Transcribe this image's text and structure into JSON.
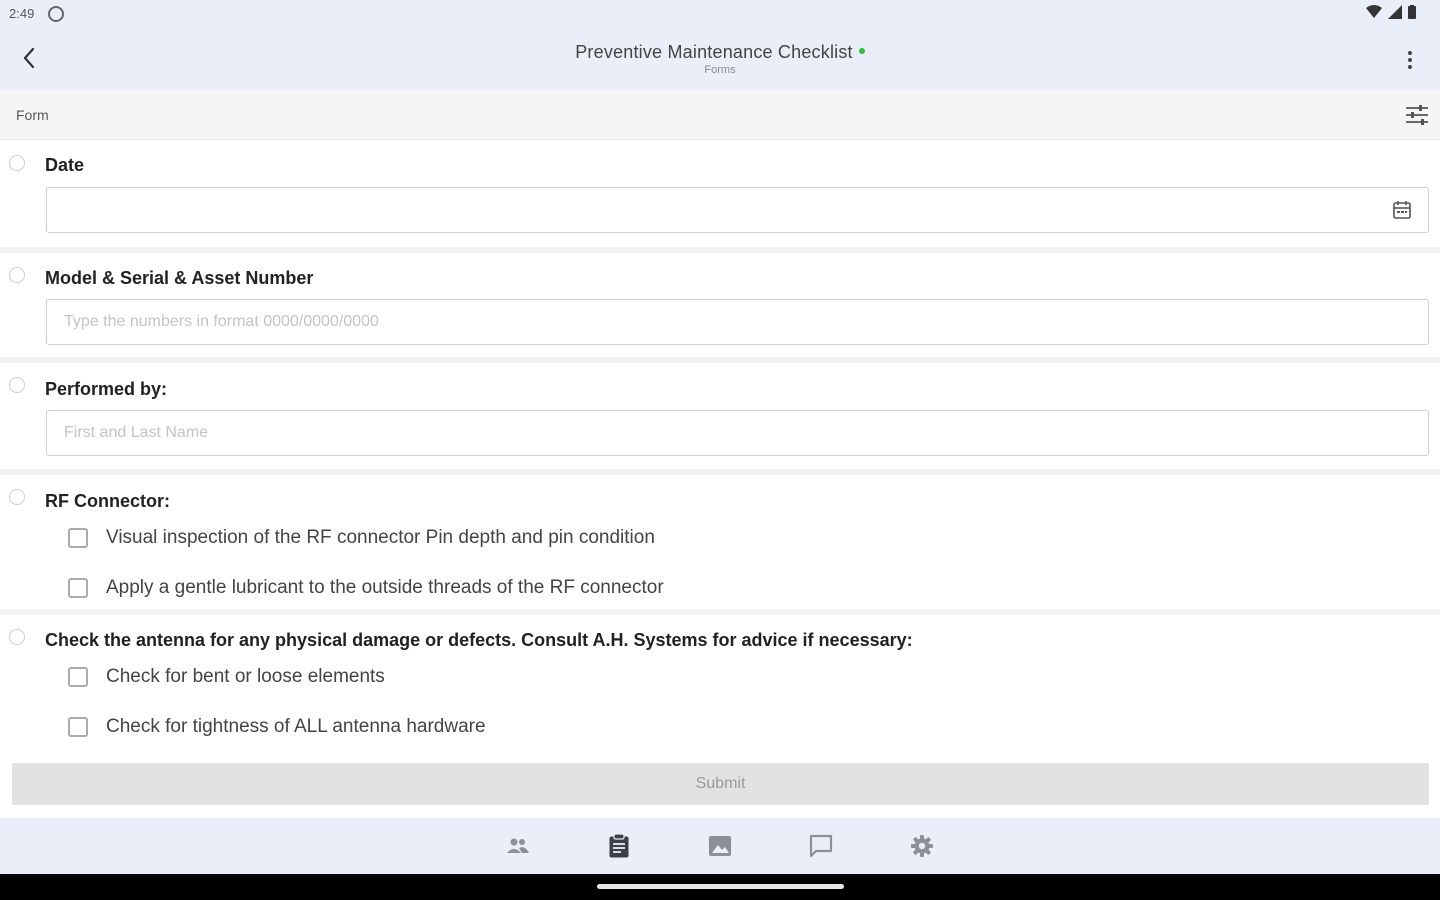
{
  "status": {
    "time": "2:49"
  },
  "header": {
    "title": "Preventive Maintenance Checklist",
    "subtitle": "Forms"
  },
  "formbar": {
    "label": "Form"
  },
  "questions": {
    "date": {
      "label": "Date",
      "value": ""
    },
    "model": {
      "label": "Model & Serial & Asset Number",
      "placeholder": "Type the numbers in format 0000/0000/0000"
    },
    "performed": {
      "label": "Performed by:",
      "placeholder": "First and Last Name"
    },
    "rf": {
      "label": "RF Connector:",
      "options": [
        "Visual inspection of the RF connector Pin depth and pin condition",
        "Apply a gentle lubricant to the outside threads of the RF connector"
      ]
    },
    "antenna": {
      "label": "Check the antenna for any physical damage or defects. Consult A.H. Systems for advice if necessary:",
      "options": [
        "Check for bent or loose elements",
        "Check for tightness of ALL antenna hardware"
      ]
    }
  },
  "submit": {
    "label": "Submit"
  },
  "nav": {
    "items": [
      "people-icon",
      "clipboard-icon",
      "image-icon",
      "chat-icon",
      "settings-icon"
    ],
    "active": "clipboard-icon"
  },
  "colors": {
    "bar_bg": "#e9eef8",
    "online_dot": "#2fbf3a"
  }
}
